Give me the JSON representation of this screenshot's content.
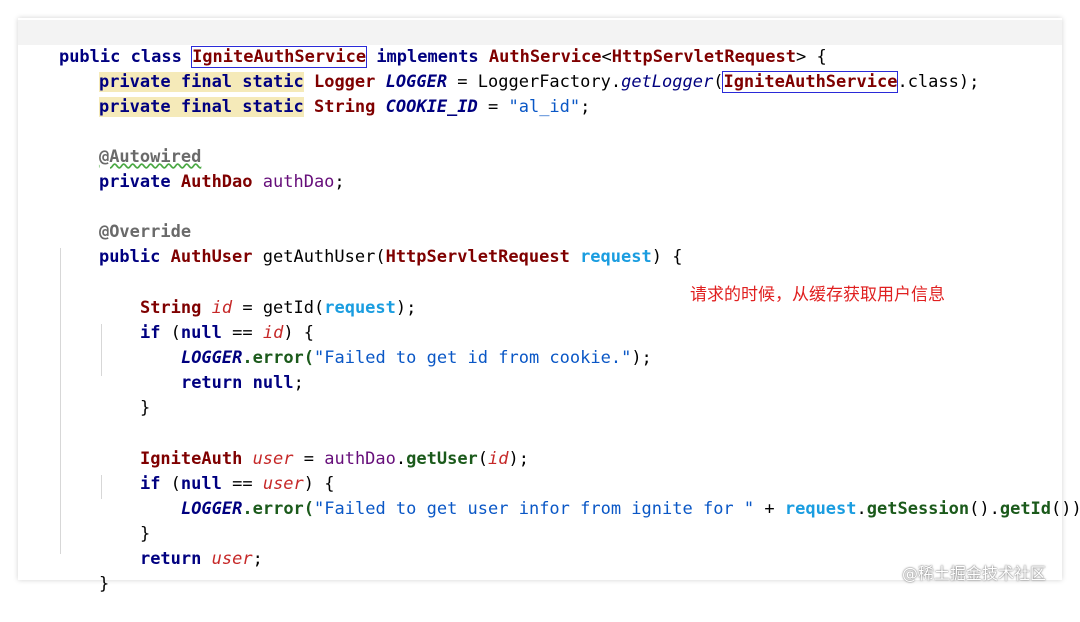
{
  "code": {
    "l1": {
      "pub": "public",
      "cls": "class",
      "name": "IgniteAuthService",
      "impl": "implements",
      "iface": "AuthService",
      "lt": "<",
      "gen": "HttpServletRequest",
      "gt": ">",
      "brace": " {"
    },
    "l2": {
      "priv": "private",
      "fin": "final",
      "stat": "static",
      "type": "Logger",
      "name": "LOGGER",
      "eq": " = ",
      "factory": "LoggerFactory.",
      "method": "getLogger",
      "open": "(",
      "arg": "IgniteAuthService",
      "end": ".class);"
    },
    "l3": {
      "priv": "private",
      "fin": "final",
      "stat": "static",
      "type": "String",
      "name": "COOKIE_ID",
      "eq": " = ",
      "val": "\"al_id\"",
      "semi": ";"
    },
    "l4": {
      "ann": "@Autowired"
    },
    "l5": {
      "priv": "private",
      "type": "AuthDao",
      "name": "authDao",
      "semi": ";"
    },
    "l6": {
      "ann": "@Override"
    },
    "l7": {
      "pub": "public",
      "type": "AuthUser",
      "method": " getAuthUser(",
      "ptype": "HttpServletRequest",
      "pname": "request",
      "end": ") {"
    },
    "l8": {
      "type": "String",
      "var": "id",
      "eq": " = getId(",
      "arg": "request",
      "end": ");"
    },
    "l9": {
      "kw": "if",
      "open": " (",
      "nul": "null",
      "op": " == ",
      "var": "id",
      "end": ") {"
    },
    "l10": {
      "logger": "LOGGER",
      "method": ".error(",
      "msg": "\"Failed to get id from cookie.\"",
      "end": ");"
    },
    "l11": {
      "ret": "return",
      "nul": "null",
      "semi": ";"
    },
    "l12": {
      "brace": "}"
    },
    "l13": {
      "type": "IgniteAuth",
      "var": "user",
      "eq": " = ",
      "dao": "authDao",
      "dot": ".",
      "method": "getUser",
      "open": "(",
      "arg": "id",
      "end": ");"
    },
    "l14": {
      "kw": "if",
      "open": " (",
      "nul": "null",
      "op": " == ",
      "var": "user",
      "end": ") {"
    },
    "l15": {
      "logger": "LOGGER",
      "method": ".error(",
      "msg": "\"Failed to get user infor from ignite for \"",
      "plus": " + ",
      "req": "request",
      "dot": ".",
      "m1": "getSession",
      "mid": "().",
      "m2": "getId",
      "end": "());"
    },
    "l16": {
      "brace": "}"
    },
    "l17": {
      "ret": "return",
      "var": "user",
      "semi": ";"
    },
    "l18": {
      "brace": "}"
    }
  },
  "annotation_note": "请求的时候，从缓存获取用户信息",
  "watermark": "@稀土掘金技术社区"
}
